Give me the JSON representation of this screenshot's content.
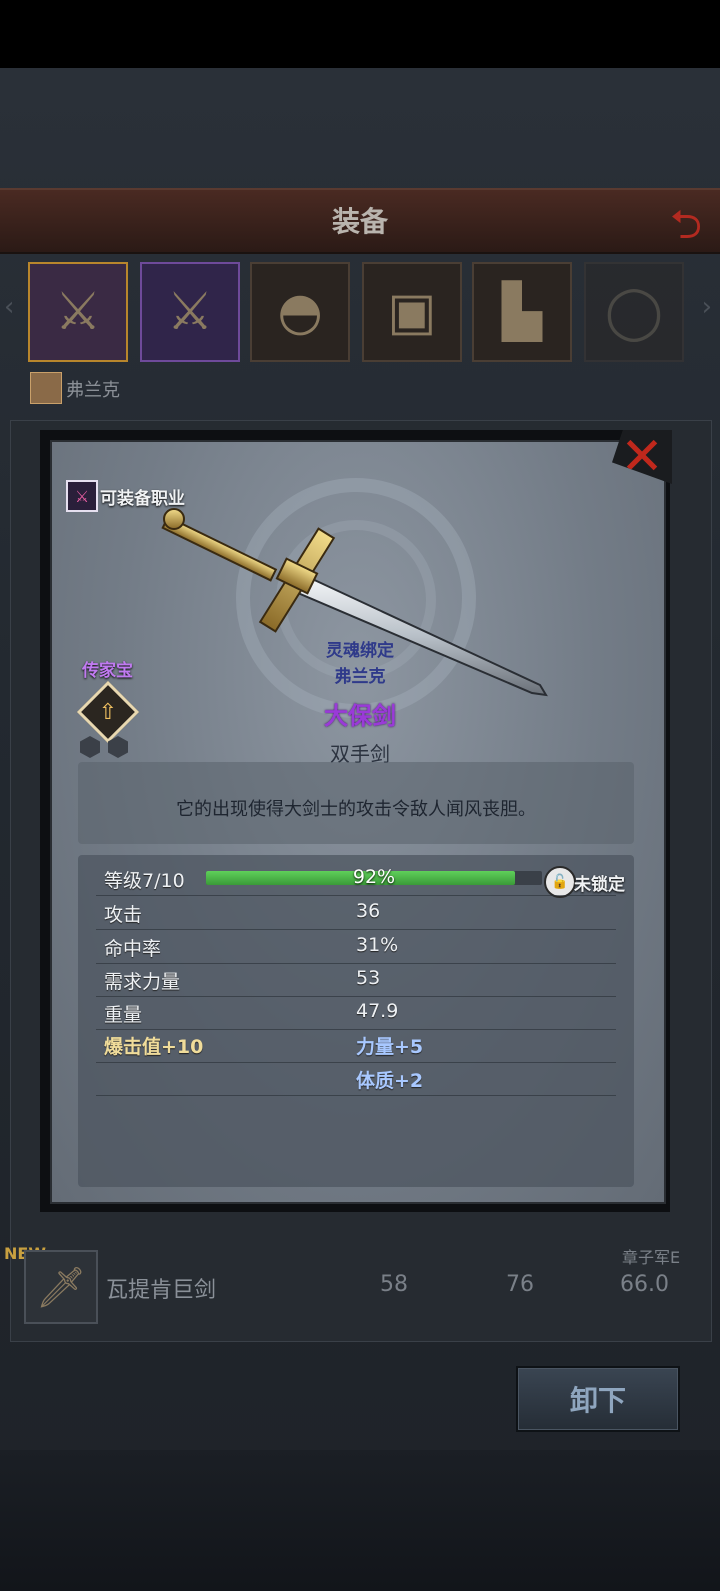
{
  "header": {
    "title": "装备"
  },
  "hero": {
    "name": "弗兰克"
  },
  "list_row": {
    "new_label": "NEW",
    "item_name": "瓦提肯巨剑",
    "value_1": "58",
    "value_2": "76",
    "value_3": "66.0",
    "tag": "章子军E"
  },
  "unequip_button": {
    "label": "卸下"
  },
  "modal": {
    "class_label": "可装备职业",
    "rarity_label": "传家宝",
    "soulbound_label": "灵魂绑定",
    "soulbound_owner": "弗兰克",
    "item_name": "大保剑",
    "item_type": "双手剑",
    "description": "它的出现使得大剑士的攻击令敌人闻风丧胆。",
    "level_label": "等级7/10",
    "xp_percent_text": "92%",
    "xp_fraction": 0.92,
    "lock_label": "未锁定",
    "stats": [
      {
        "label": "攻击",
        "value": "36"
      },
      {
        "label": "命中率",
        "value": "31%"
      },
      {
        "label": "需求力量",
        "value": "53"
      },
      {
        "label": "重量",
        "value": "47.9"
      }
    ],
    "bonus_left": "爆击值+10",
    "bonus_right_1": "力量+5",
    "bonus_right_2": "体质+2"
  },
  "colors": {
    "rarity_purple": "#9a3ad8",
    "xp_green": "#5fd05a",
    "close_red": "#c0281c"
  }
}
